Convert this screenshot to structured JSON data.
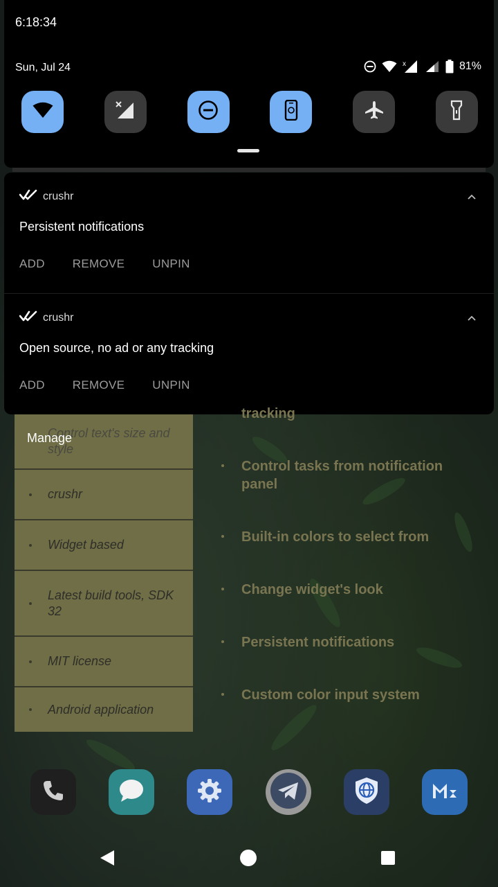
{
  "status_bar": {
    "clock": "6:18:34",
    "date": "Sun, Jul 24",
    "battery": "81%"
  },
  "quick_settings": {
    "tiles": [
      {
        "name": "wifi-tile",
        "icon": "wifi-icon",
        "on": true
      },
      {
        "name": "mobile-data-tile",
        "icon": "mobile-data-off-icon",
        "on": false
      },
      {
        "name": "dnd-tile",
        "icon": "do-not-disturb-icon",
        "on": true
      },
      {
        "name": "auto-rotate-tile",
        "icon": "auto-rotate-icon",
        "on": true
      },
      {
        "name": "airplane-mode-tile",
        "icon": "airplane-icon",
        "on": false
      },
      {
        "name": "flashlight-tile",
        "icon": "flashlight-icon",
        "on": false
      }
    ]
  },
  "notifications": [
    {
      "app": "crushr",
      "title": "Persistent notifications",
      "actions": [
        "ADD",
        "REMOVE",
        "UNPIN"
      ]
    },
    {
      "app": "crushr",
      "title": "Open source, no ad or any tracking",
      "actions": [
        "ADD",
        "REMOVE",
        "UNPIN"
      ]
    }
  ],
  "widget": {
    "manage_label": "Manage",
    "items": [
      "Control text's size and style",
      "crushr",
      "Widget based",
      "Latest build tools, SDK 32",
      "MIT license",
      "Android application"
    ]
  },
  "features": {
    "partial_top": "tracking",
    "items": [
      "Control tasks from notification panel",
      "Built-in colors to select from",
      "Change widget's look",
      "Persistent notifications",
      "Custom color input system"
    ]
  },
  "dock": {
    "apps": [
      "phone-icon",
      "messages-icon",
      "settings-icon",
      "telegram-icon",
      "browser-icon",
      "mail-icon"
    ]
  },
  "colors": {
    "tile_on": "#75b0f5",
    "tile_off": "#3a3a3a",
    "widget_bg": "#706e47",
    "feature_text": "#7a7551"
  }
}
